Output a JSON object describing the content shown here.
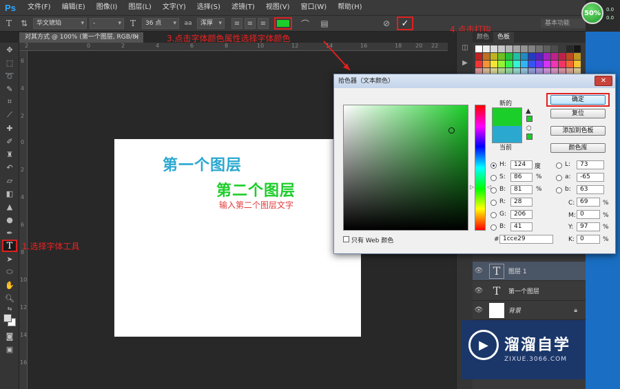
{
  "app": {
    "logo": "Ps"
  },
  "menu": [
    "文件(F)",
    "编辑(E)",
    "图像(I)",
    "图层(L)",
    "文字(Y)",
    "选择(S)",
    "滤镜(T)",
    "视图(V)",
    "窗口(W)",
    "帮助(H)"
  ],
  "options": {
    "font_family": "华文琥珀",
    "font_style": "-",
    "font_size": "36 点",
    "antialias_label": "aa",
    "antialias": "浑厚",
    "text_color": "#1cce29",
    "workspace": "基本功能"
  },
  "document": {
    "tab_title": "对其方式 @ 100% (第一个图层, RGB/8) *",
    "close": "×"
  },
  "ruler": {
    "h_ticks": [
      "2",
      "0",
      "2",
      "4",
      "6",
      "8",
      "10",
      "12",
      "14",
      "16",
      "18",
      "20",
      "22"
    ],
    "v_ticks": [
      "6",
      "4",
      "2",
      "0",
      "2",
      "4",
      "6",
      "8",
      "10",
      "12",
      "14",
      "16"
    ]
  },
  "canvas": {
    "text1": "第一个图层",
    "text2": "第二个图层",
    "text3": "输入第二个图层文字"
  },
  "annotations": {
    "step1": "1.选择字体工具",
    "step3": "3.点击字体颜色属性选择字体颜色",
    "step4": "4.点击打钩"
  },
  "panels": {
    "tabs": [
      "颜色",
      "色板"
    ],
    "layers": [
      {
        "name": "图层 1"
      },
      {
        "name": "第一个图层"
      },
      {
        "name": "背景"
      }
    ]
  },
  "dialog": {
    "title": "拾色器（文本颜色）",
    "new_label": "新的",
    "current_label": "当前",
    "ok": "确定",
    "reset": "复位",
    "add_swatch": "添加到色板",
    "color_library": "颜色库",
    "h": "124",
    "h_unit": "度",
    "s": "86",
    "s_unit": "%",
    "b": "81",
    "b_unit": "%",
    "r": "28",
    "g": "206",
    "bv": "41",
    "l": "73",
    "a": "-65",
    "bl": "63",
    "c": "69",
    "m": "0",
    "y": "97",
    "k": "0",
    "hex": "1cce29",
    "web_only": "只有 Web 颜色",
    "labels": {
      "H": "H:",
      "S": "S:",
      "B": "B:",
      "R": "R:",
      "G": "G:",
      "Bb": "B:",
      "L": "L:",
      "a": "a:",
      "b": "b:",
      "C": "C:",
      "M": "M:",
      "Y": "Y:",
      "K": "K:",
      "hash": "#"
    }
  },
  "status": {
    "percent": "50%",
    "net_up": "0.0",
    "net_down": "0.0"
  },
  "watermark": {
    "title": "溜溜自学",
    "url": "ZIXUE.3066.COM"
  },
  "colors": {
    "accent_red": "#e02020",
    "text_green": "#1cce29",
    "text_blue": "#2aa8d0"
  }
}
